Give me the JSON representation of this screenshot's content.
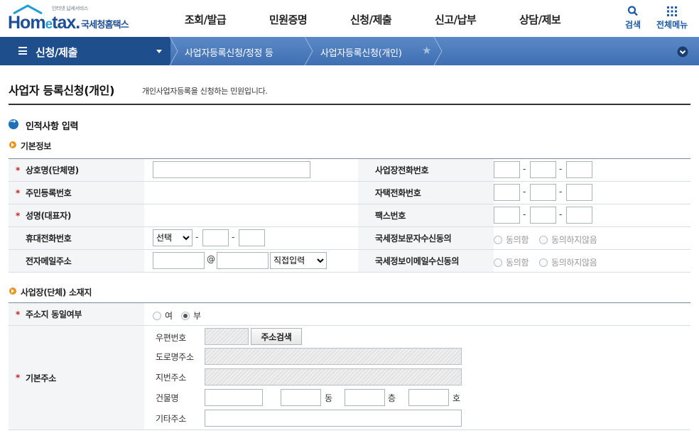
{
  "header": {
    "logo_tagline": "인터넷 납세서비스",
    "logo_brand_a": "Hom",
    "logo_brand_e": "e",
    "logo_brand_b": "tax.",
    "logo_sub": "국세청홈택스",
    "menu": [
      "조회/발급",
      "민원증명",
      "신청/제출",
      "신고/납부",
      "상담/제보"
    ],
    "search_label": "검색",
    "allmenu_label": "전체메뉴"
  },
  "nav": {
    "current": "신청/제출",
    "crumbs": [
      "사업자등록신청/정정 등",
      "사업자등록신청(개인)"
    ]
  },
  "page": {
    "title": "사업자 등록신청(개인)",
    "description": "개인사업자등록을 신청하는 민원입니다."
  },
  "section1": {
    "title": "인적사항 입력",
    "sub_title": "기본정보",
    "rows_left": [
      "상호명(단체명)",
      "주민등록번호",
      "성명(대표자)",
      "휴대전화번호",
      "전자메일주소"
    ],
    "rows_right": [
      "사업장전화번호",
      "자택전화번호",
      "팩스번호",
      "국세정보문자수신동의",
      "국세정보이메일수신동의"
    ],
    "phone_select": "선택",
    "email_at": "@",
    "email_select": "직접입력",
    "dash": "-",
    "agree": "동의함",
    "disagree": "동의하지않음"
  },
  "section2": {
    "title": "사업장(단체) 소재지",
    "same_label": "주소지 동일여부",
    "yes": "여",
    "no": "부",
    "addr_label": "기본주소",
    "zip_label": "우편번호",
    "search_button": "주소검색",
    "road_label": "도로명주소",
    "jibun_label": "지번주소",
    "building_label": "건물명",
    "dong": "동",
    "floor": "층",
    "ho": "호",
    "etc_label": "기타주소"
  },
  "colors": {
    "nav_dark": "#1f4e8c",
    "nav": "#4c7dbe",
    "brand": "#1d4f95",
    "required": "#c6251f"
  }
}
